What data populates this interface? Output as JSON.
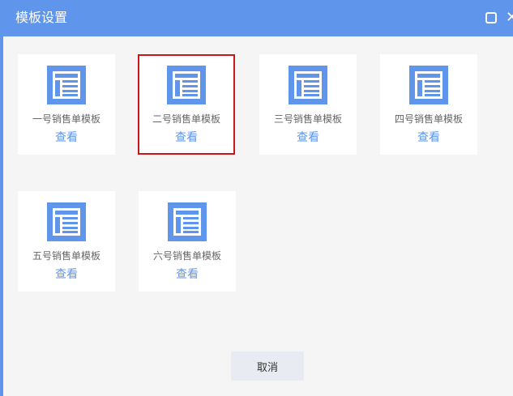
{
  "dialog": {
    "title": "模板设置",
    "maximize_icon": "square-outline-icon",
    "close_icon": "close-x-icon",
    "close_label": "✕"
  },
  "templates": [
    {
      "name": "一号销售单模板",
      "link": "查看",
      "selected": false
    },
    {
      "name": "二号销售单模板",
      "link": "查看",
      "selected": true
    },
    {
      "name": "三号销售单模板",
      "link": "查看",
      "selected": false
    },
    {
      "name": "四号销售单模板",
      "link": "查看",
      "selected": false
    },
    {
      "name": "五号销售单模板",
      "link": "查看",
      "selected": false
    },
    {
      "name": "六号销售单模板",
      "link": "查看",
      "selected": false
    }
  ],
  "footer": {
    "cancel_label": "取消"
  },
  "colors": {
    "accent": "#5f95ea",
    "selected_border": "#c8161d",
    "background": "#f5f5f5",
    "card": "#ffffff",
    "button_bg": "#e8ebf1"
  }
}
